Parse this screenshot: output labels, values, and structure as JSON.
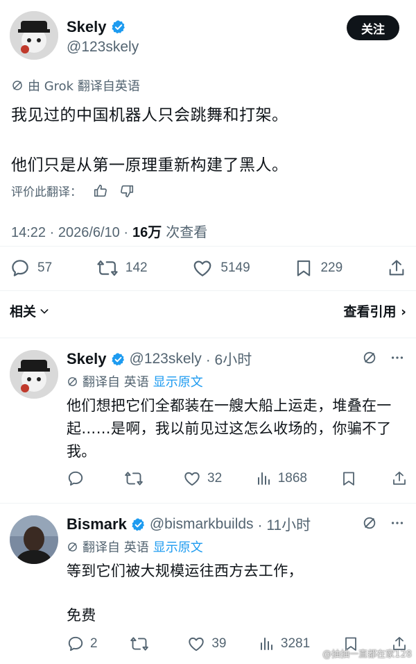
{
  "main_tweet": {
    "author_name": "Skely",
    "handle": "@123skely",
    "follow_label": "关注",
    "translated_note": "由 Grok 翻译自英语",
    "text_line1": "我见过的中国机器人只会跳舞和打架。",
    "text_line2": "他们只是从第一原理重新构建了黑人。",
    "rate_label": "评价此翻译：",
    "time": "14:22 · 2026/6/10 ·",
    "views_count": "16万",
    "views_label": "次查看",
    "replies": "57",
    "retweets": "142",
    "likes": "5149",
    "bookmarks": "229"
  },
  "related": {
    "label": "相关",
    "quotes_label": "查看引用 ›"
  },
  "replies": [
    {
      "author_name": "Skely",
      "handle": "@123skely",
      "time": "· 6小时",
      "translated_label": "翻译自 英语",
      "show_original": "显示原文",
      "text": "他们想把它们全都装在一艘大船上运走，堆叠在一起……是啊，我以前见过这怎么收场的，你骗不了我。",
      "replies": "",
      "retweets": "",
      "likes": "32",
      "views": "1868"
    },
    {
      "author_name": "Bismark",
      "handle": "@bismarkbuilds",
      "time": "· 11小时",
      "translated_label": "翻译自 英语",
      "show_original": "显示原文",
      "text_line1": "等到它们被大规模运往西方去工作，",
      "text_line2": "免费",
      "replies": "2",
      "retweets": "",
      "likes": "39",
      "views": "3281"
    }
  ],
  "watermark": "@抽抽一直都在家128",
  "colors": {
    "text": "#0f1419",
    "secondary": "#536471",
    "link": "#1d9bf0",
    "verified": "#1d9bf0",
    "follow_bg": "#0f1419"
  }
}
